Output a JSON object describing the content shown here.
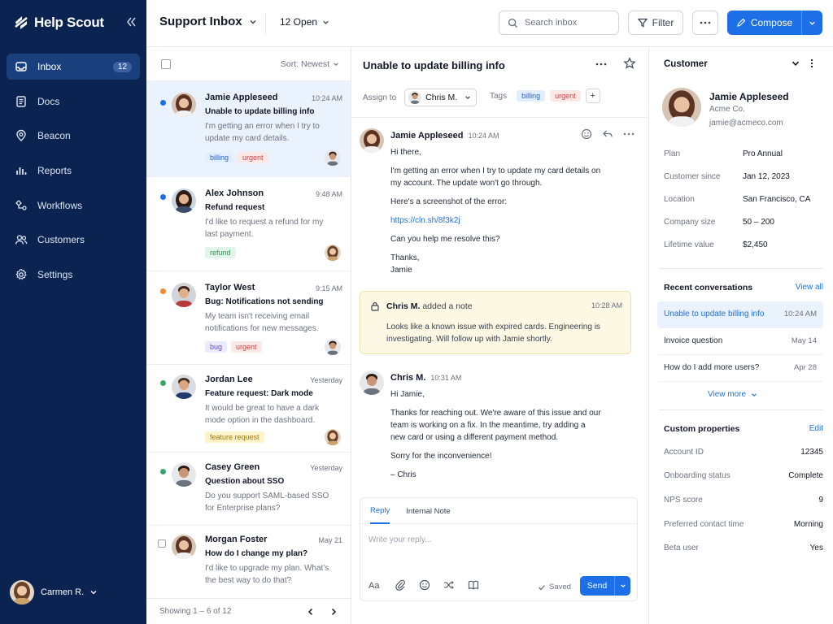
{
  "brand": {
    "name": "Help Scout"
  },
  "sidebar": {
    "items": [
      {
        "label": "Inbox",
        "badge": "12",
        "icon": "inbox-icon",
        "active": true
      },
      {
        "label": "Docs",
        "icon": "docs-icon"
      },
      {
        "label": "Beacon",
        "icon": "beacon-icon"
      },
      {
        "label": "Reports",
        "icon": "reports-icon"
      },
      {
        "label": "Workflows",
        "icon": "workflows-icon"
      },
      {
        "label": "Customers",
        "icon": "customers-icon"
      },
      {
        "label": "Settings",
        "icon": "settings-icon"
      }
    ],
    "user": {
      "name": "Carmen R."
    }
  },
  "topbar": {
    "title": "Support Inbox",
    "open_filter": "12 Open",
    "search_placeholder": "Search inbox",
    "filter_label": "Filter",
    "compose_label": "Compose"
  },
  "list": {
    "sort_label": "Sort: Newest",
    "conversations": [
      {
        "name": "Jamie Appleseed",
        "time": "10:24 AM",
        "subject": "Unable to update billing info",
        "preview": "I'm getting an error when I try to update my card details.",
        "tags": [
          "billing",
          "urgent"
        ],
        "unread": "blue"
      },
      {
        "name": "Alex Johnson",
        "time": "9:48 AM",
        "subject": "Refund request",
        "preview": "I'd like to request a refund for my last payment.",
        "tags": [
          "refund"
        ],
        "unread": "blue"
      },
      {
        "name": "Taylor West",
        "time": "9:15 AM",
        "subject": "Bug: Notifications not sending",
        "preview": "My team isn't receiving email notifications for new messages.",
        "tags": [
          "bug",
          "urgent"
        ],
        "unread": "orange"
      },
      {
        "name": "Jordan Lee",
        "time": "Yesterday",
        "subject": "Feature request: Dark mode",
        "preview": "It would be great to have a dark mode option in the dashboard.",
        "tags": [
          "feature request"
        ],
        "unread": "green"
      },
      {
        "name": "Casey Green",
        "time": "Yesterday",
        "subject": "Question about SSO",
        "preview": "Do you support SAML-based SSO for Enterprise plans?",
        "tags": [],
        "unread": "green"
      },
      {
        "name": "Morgan Foster",
        "time": "May 21",
        "subject": "How do I change my plan?",
        "preview": "I'd like to upgrade my plan. What's the best way to do that?",
        "tags": [],
        "unread": "none"
      }
    ],
    "footer": "Showing 1 – 6 of 12"
  },
  "detail": {
    "title": "Unable to update billing info",
    "assign_label": "Assign to",
    "assignee": "Chris M.",
    "tags_label": "Tags",
    "tags": [
      "billing",
      "urgent"
    ],
    "message1": {
      "author": "Jamie Appleseed",
      "time": "10:24 AM",
      "greeting": "Hi there,",
      "p1": "I'm getting an error when I try to update my card details on my account. The update won't go through.",
      "p2": "Here's a screenshot of the error:",
      "link": "https://cln.sh/8f3k2j",
      "p3": "Can you help me resolve this?",
      "signoff": "Thanks,",
      "signature": "Jamie"
    },
    "note": {
      "author": "Chris M.",
      "action": "added a note",
      "time": "10:28 AM",
      "text": "Looks like a known issue with expired cards. Engineering is investigating. Will follow up with Jamie shortly."
    },
    "message2": {
      "author": "Chris M.",
      "time": "10:31 AM",
      "greeting": "Hi Jamie,",
      "p1": "Thanks for reaching out. We're aware of this issue and our team is working on a fix. In the meantime, try adding a new card or using a different payment method.",
      "p2": "Sorry for the inconvenience!",
      "signature": "– Chris"
    },
    "reply": {
      "tab_reply": "Reply",
      "tab_note": "Internal Note",
      "placeholder": "Write your reply...",
      "saved": "Saved",
      "send": "Send"
    }
  },
  "customer": {
    "header": "Customer",
    "name": "Jamie Appleseed",
    "company": "Acme Co.",
    "email": "jamie@acmeco.com",
    "fields": [
      {
        "k": "Plan",
        "v": "Pro Annual"
      },
      {
        "k": "Customer since",
        "v": "Jan 12, 2023"
      },
      {
        "k": "Location",
        "v": "San Francisco, CA"
      },
      {
        "k": "Company size",
        "v": "50 – 200"
      },
      {
        "k": "Lifetime value",
        "v": "$2,450"
      }
    ],
    "recent_title": "Recent conversations",
    "view_all": "View all",
    "recent": [
      {
        "s": "Unable to update billing info",
        "d": "10:24 AM"
      },
      {
        "s": "Invoice question",
        "d": "May 14"
      },
      {
        "s": "How do I add more users?",
        "d": "Apr 28"
      }
    ],
    "view_more": "View more",
    "props_title": "Custom properties",
    "edit": "Edit",
    "props": [
      {
        "k": "Account ID",
        "v": "12345"
      },
      {
        "k": "Onboarding status",
        "v": "Complete"
      },
      {
        "k": "NPS score",
        "v": "9"
      },
      {
        "k": "Preferred contact time",
        "v": "Morning"
      },
      {
        "k": "Beta user",
        "v": "Yes"
      }
    ]
  },
  "colors": {
    "sidebar_bg": "#0b2350",
    "accent": "#1d6fe8",
    "unread_blue": "#1d6fe8",
    "unread_orange": "#f08a24",
    "unread_green": "#3aa56a"
  }
}
